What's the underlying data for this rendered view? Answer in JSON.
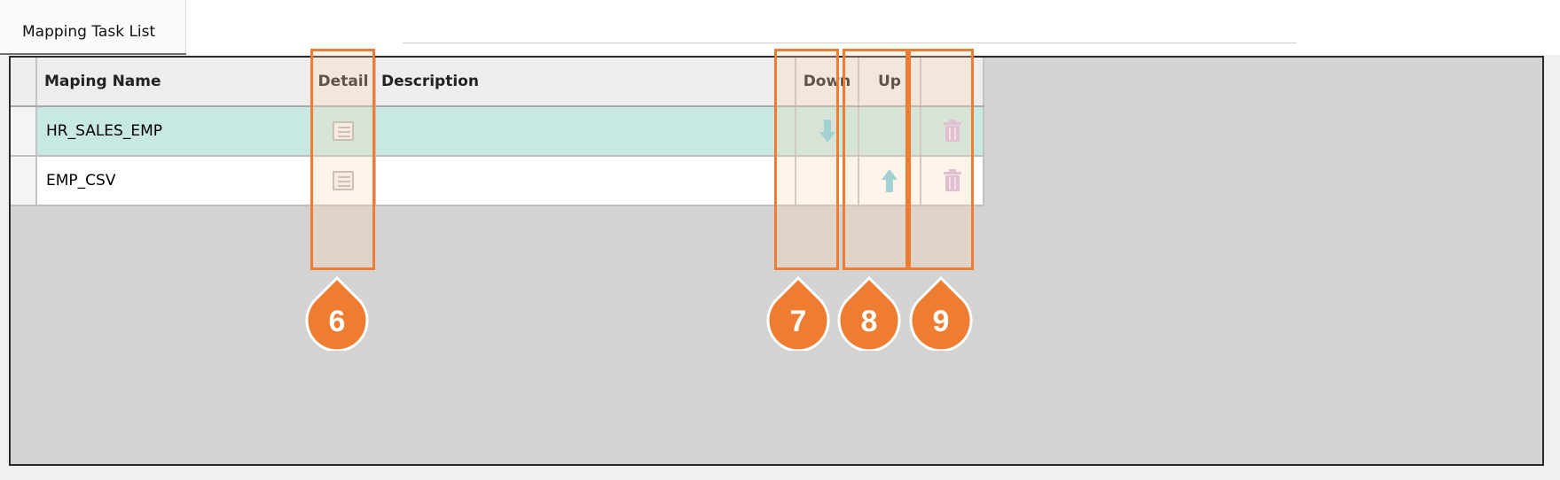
{
  "tab": {
    "label": "Mapping Task List"
  },
  "grid": {
    "columns": {
      "name": "Maping Name",
      "detail": "Detail",
      "description": "Description",
      "down": "Down",
      "up": "Up",
      "delete": ""
    },
    "rows": [
      {
        "name": "HR_SALES_EMP",
        "description": "",
        "down_icon": "arrow-down-icon",
        "up_icon": "",
        "delete_icon": "trash-icon"
      },
      {
        "name": "EMP_CSV",
        "description": "",
        "down_icon": "",
        "up_icon": "arrow-up-icon",
        "delete_icon": "trash-icon"
      }
    ]
  },
  "annotations": [
    {
      "number": "6",
      "target": "detail-column"
    },
    {
      "number": "7",
      "target": "down-column"
    },
    {
      "number": "8",
      "target": "up-column"
    },
    {
      "number": "9",
      "target": "delete-column"
    }
  ],
  "colors": {
    "accent": "#ee7d31",
    "selected_row": "#c8e8e2",
    "grid_background": "#d3d3d3",
    "arrow_icon": "#7fcde0",
    "trash_icon": "#d6b6dc"
  }
}
